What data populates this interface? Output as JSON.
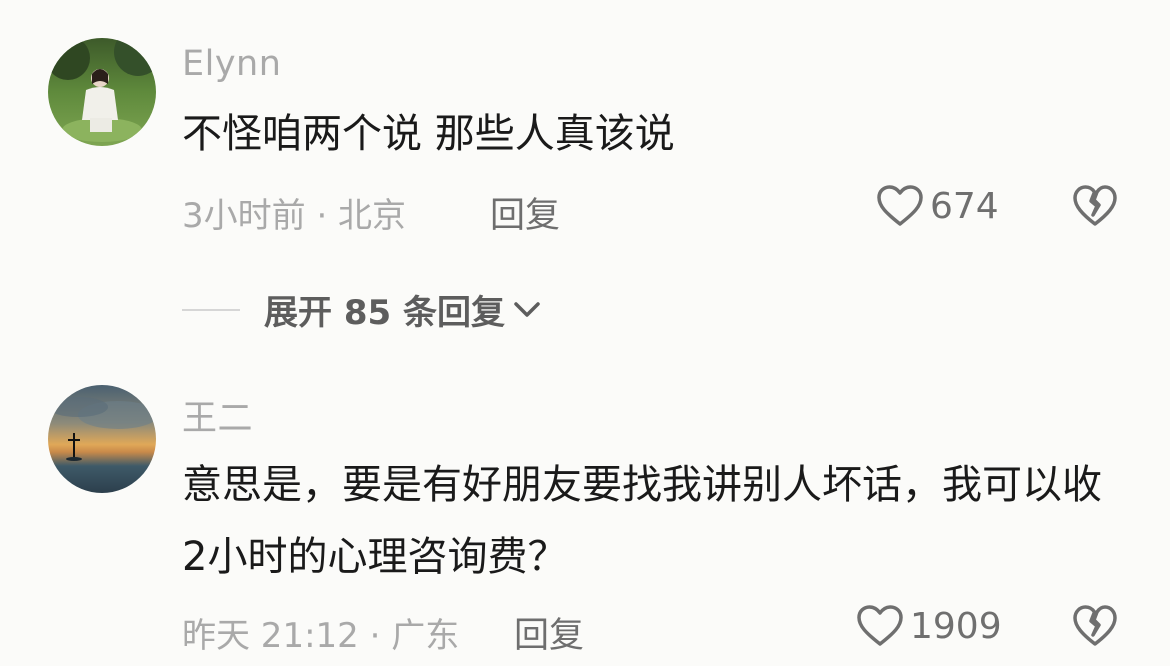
{
  "comments": [
    {
      "username": "Elynn",
      "text": "不怪咱两个说 那些人真该说",
      "meta": "3小时前 · 北京",
      "reply_label": "回复",
      "likes": "674",
      "avatar_icon": "avatar-photo-girl-sitting",
      "expand_label": "展开 85 条回复"
    },
    {
      "username": "王二",
      "text": "意思是，要是有好朋友要找我讲别人坏话，我可以收2小时的心理咨询费？",
      "meta": "昨天 21:12 · 广东",
      "reply_label": "回复",
      "likes": "1909",
      "avatar_icon": "avatar-photo-sunset-sea"
    }
  ],
  "icons": {
    "like": "heart-outline-icon",
    "dislike": "broken-heart-icon",
    "expand": "chevron-down-icon"
  },
  "colors": {
    "background": "#fbfbf9",
    "text_primary": "#1a1a1a",
    "text_secondary": "#a9a9a9",
    "icon": "#6f6f6f"
  }
}
